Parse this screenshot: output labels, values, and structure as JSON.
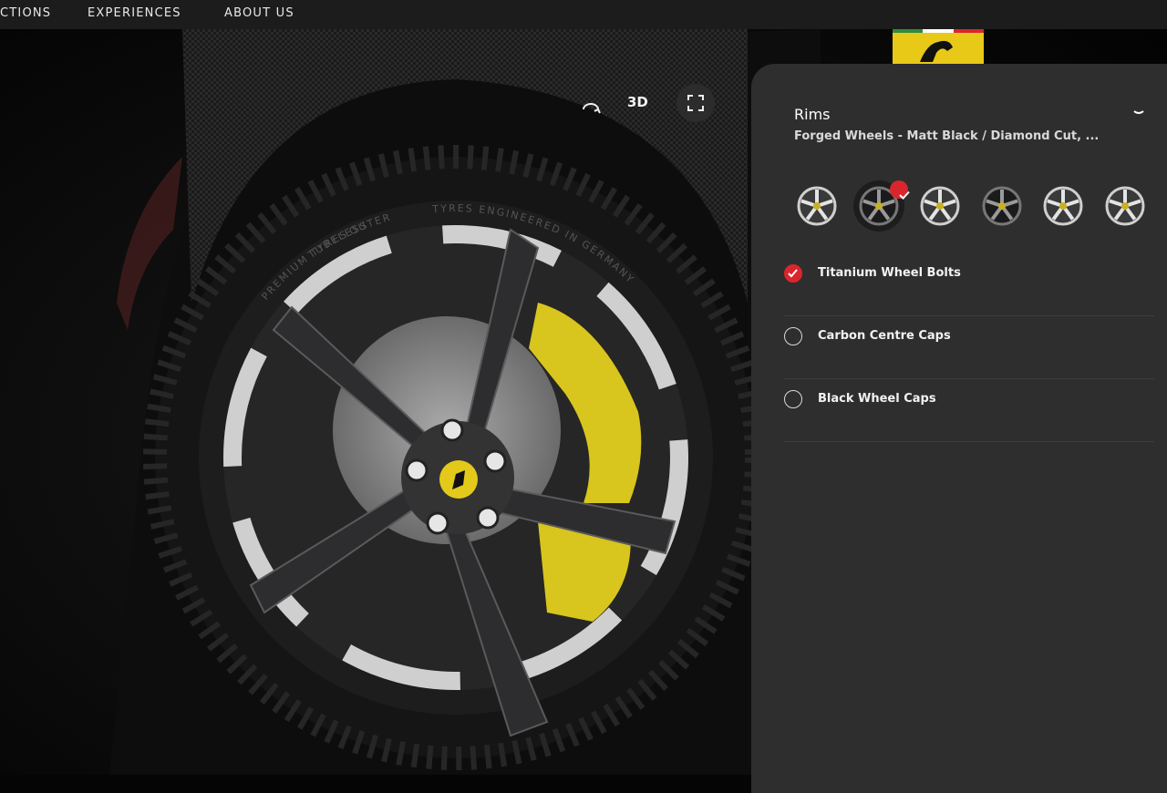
{
  "nav": {
    "items": [
      {
        "label": "CTIONS"
      },
      {
        "label": "EXPERIENCES"
      },
      {
        "label": "ABOUT US"
      }
    ]
  },
  "viewer": {
    "mode_label": "3D",
    "tyre": {
      "text_premium": "PREMIUM TYRES",
      "text_tubeless": "TUBELESS",
      "text_outer": "OUTER",
      "text_engineered": "TYRES ENGINEERED IN GERMANY"
    },
    "colors": {
      "caliper": "#d8c51e",
      "badge": "#e3c91a",
      "rim_face": "#c9c9c9",
      "rim_spoke": "#2d2d2f"
    }
  },
  "panel": {
    "rims": {
      "title": "Rims",
      "subtitle": "Forged Wheels - Matt Black / Diamond Cut, ...",
      "options": [
        {
          "icon": "rim-silver-icon",
          "selected": false
        },
        {
          "icon": "rim-black-icon",
          "selected": true
        },
        {
          "icon": "rim-silver-icon",
          "selected": false
        },
        {
          "icon": "rim-black-icon",
          "selected": false
        },
        {
          "icon": "rim-silver-icon",
          "selected": false
        },
        {
          "icon": "rim-silver-icon",
          "selected": false
        }
      ]
    },
    "extras": [
      {
        "label": "Titanium Wheel Bolts",
        "checked": true
      },
      {
        "label": "Carbon Centre Caps",
        "checked": false
      },
      {
        "label": "Black Wheel Caps",
        "checked": false
      }
    ],
    "accent_color": "#d9262c"
  }
}
